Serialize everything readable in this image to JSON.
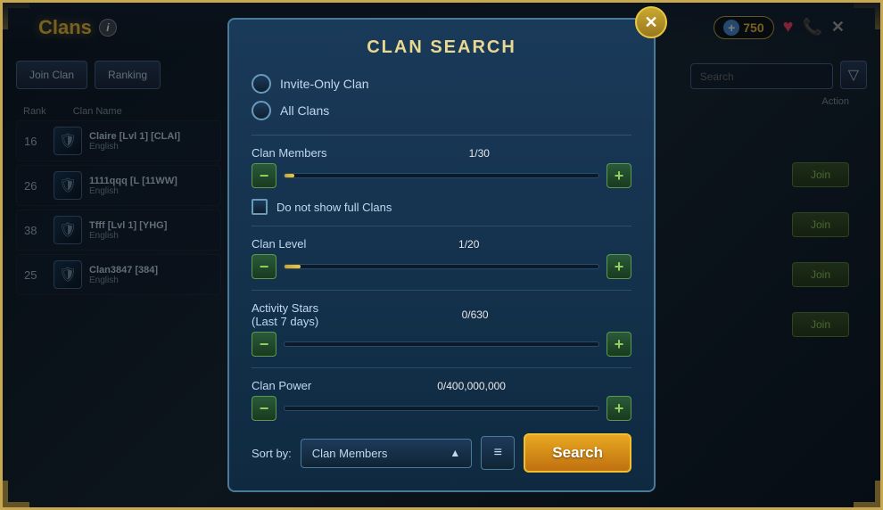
{
  "app": {
    "title": "Clans",
    "currency": "+750",
    "topbar": {
      "info_icon": "i",
      "close_label": "✕",
      "heart_icon": "♥",
      "phone_icon": "📞"
    }
  },
  "clan_list": {
    "buttons": {
      "join": "Join Clan",
      "ranking": "Ranking"
    },
    "headers": {
      "rank": "Rank",
      "clan_name": "Clan Name",
      "action": "Action"
    },
    "rows": [
      {
        "rank": "16",
        "name": "Claire [Lvl 1] [CLAI]",
        "lang": "English",
        "emblem": "🛡"
      },
      {
        "rank": "26",
        "name": "1111qqq [L [11WW]",
        "lang": "English",
        "emblem": "🛡"
      },
      {
        "rank": "38",
        "name": "Tfff [Lvl 1] [YHG]",
        "lang": "English",
        "emblem": "🛡"
      },
      {
        "rank": "25",
        "name": "Clan3847 [384]",
        "lang": "English",
        "emblem": "🛡"
      }
    ],
    "join_buttons": [
      "Join",
      "Join",
      "Join",
      "Join"
    ]
  },
  "search_bar": {
    "placeholder": "Search",
    "search_icon": "🔍",
    "filter_icon": "▼"
  },
  "modal": {
    "title": "CLAN SEARCH",
    "close_icon": "✕",
    "radio_options": [
      {
        "label": "Invite-Only Clan",
        "selected": false
      },
      {
        "label": "All Clans",
        "selected": false
      }
    ],
    "sliders": [
      {
        "label": "Clan Members",
        "value": "1/30",
        "fill_pct": 3,
        "min_icon": "−",
        "max_icon": "+"
      },
      {
        "label": "Clan Level",
        "value": "1/20",
        "fill_pct": 5,
        "min_icon": "−",
        "max_icon": "+"
      },
      {
        "label": "Activity Stars\n(Last 7 days)",
        "label_line1": "Activity Stars",
        "label_line2": "(Last 7 days)",
        "value": "0/630",
        "fill_pct": 0,
        "min_icon": "−",
        "max_icon": "+"
      },
      {
        "label": "Clan Power",
        "value": "0/400,000,000",
        "fill_pct": 0,
        "min_icon": "−",
        "max_icon": "+"
      }
    ],
    "checkbox": {
      "label": "Do not show full Clans",
      "checked": false
    },
    "sort": {
      "label": "Sort by:",
      "selected": "Clan Members",
      "chevron": "▲",
      "order_icon": "≡"
    },
    "search_button": "Search"
  }
}
